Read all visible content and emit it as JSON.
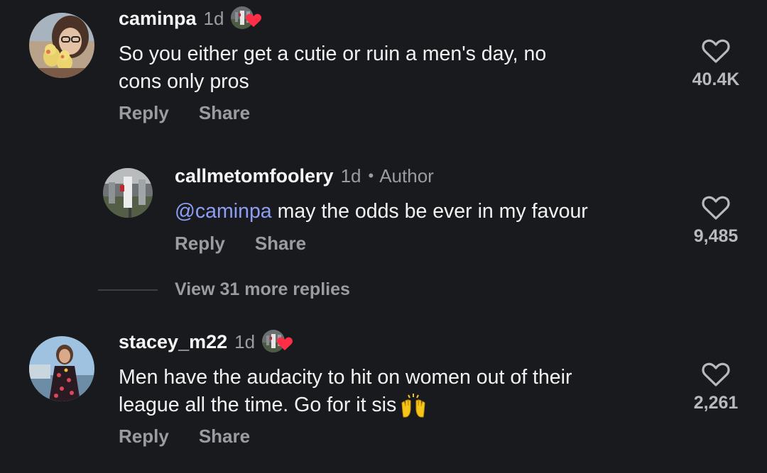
{
  "comments": [
    {
      "username": "caminpa",
      "time": "1d",
      "text_lines": [
        "So you either get a cutie or ruin a men's day, no",
        "cons only pros"
      ],
      "reply_label": "Reply",
      "share_label": "Share",
      "like_count": "40.4K",
      "liked_by_author": true
    },
    {
      "username": "callmetomfoolery",
      "time": "1d",
      "separator": "•",
      "author_label": "Author",
      "mention": "@caminpa",
      "text": " may the odds be ever in my favour",
      "reply_label": "Reply",
      "share_label": "Share",
      "like_count": "9,485"
    },
    {
      "username": "stacey_m22",
      "time": "1d",
      "text_lines": [
        "Men have the audacity to hit on women out of their",
        "league all the time. Go for it sis"
      ],
      "emoji": "raised-hands-emoji",
      "reply_label": "Reply",
      "share_label": "Share",
      "like_count": "2,261",
      "liked_by_author": true
    }
  ],
  "view_more_replies": "View 31 more replies",
  "colors": {
    "background": "#181a1d",
    "text": "#f2f2f2",
    "muted": "#9a9ca1",
    "mention": "#8d9ef5",
    "heart_red": "#ff2d45"
  },
  "icons": {
    "like": "heart-outline-icon",
    "author_like": "author-liked-badge"
  }
}
